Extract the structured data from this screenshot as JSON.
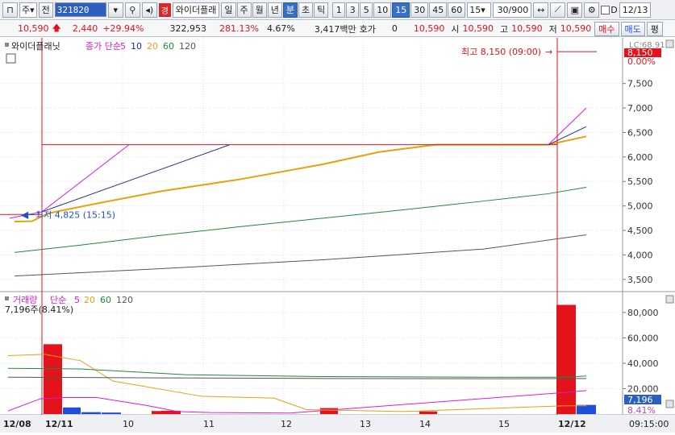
{
  "toolbar": {
    "mode": "주",
    "type": "전",
    "code": "321820",
    "name": "와이더플래",
    "badge": "경",
    "periods": [
      "일",
      "주",
      "월",
      "년",
      "분",
      "초",
      "틱"
    ],
    "active_period": "분",
    "intervals": [
      "1",
      "3",
      "5",
      "10",
      "15",
      "30",
      "45",
      "60"
    ],
    "active_interval": "15",
    "interval_select": "15",
    "count": "30/900",
    "d_label": "D",
    "date": "12/13"
  },
  "quote": {
    "price": "10,590",
    "change": "2,440",
    "change_pct": "+29.94%",
    "volume": "322,953",
    "vol_ratio": "281.13%",
    "turnover": "4.67%",
    "amount": "3,417백만",
    "hoga_label": "호가",
    "hoga": "0",
    "ask": "10,590",
    "open_label": "시",
    "open": "10,590",
    "high_label": "고",
    "high": "10,590",
    "low_label": "저",
    "low": "10,590",
    "buy": "매수",
    "sell": "매도",
    "avg": "평"
  },
  "price_panel": {
    "name": "와이더플래닛",
    "legend": [
      "종가 단순",
      "5",
      "10",
      "20",
      "60",
      "120"
    ],
    "high_annot": "최고 8,150 (09:00)",
    "low_annot": "최저 4,825 (15:15)",
    "last_tag": "8,150",
    "pct_tag": "0.00%",
    "lc_tag": "LC:68.91",
    "y_ticks": [
      "7,500",
      "7,000",
      "6,500",
      "6,000",
      "5,500",
      "5,000",
      "4,500",
      "4,000",
      "3,500"
    ]
  },
  "volume_panel": {
    "legend": [
      "거래량",
      "단순",
      "5",
      "20",
      "60",
      "120"
    ],
    "sub": "7,196주(8.41%)",
    "last_tag": "7,196",
    "pct_tag": "8.41%",
    "y_ticks": [
      "80,000",
      "60,000",
      "40,000",
      "20,000"
    ]
  },
  "x_axis": {
    "labels": [
      "12/08",
      "12/11",
      "10",
      "11",
      "12",
      "13",
      "14",
      "15",
      "12/12"
    ],
    "time": "09:15:00"
  },
  "colors": {
    "up": "#e3121b",
    "down": "#1f4fd8",
    "ma5": "#d81bd8",
    "ma10": "#1a2d8f",
    "ma20": "#e8a010",
    "ma60": "#1b8a3a",
    "ma120": "#555555"
  },
  "chart_data": {
    "type": "bar",
    "price": {
      "ylim": [
        3300,
        8300
      ],
      "high": 8150,
      "low": 4825,
      "series": [
        {
          "name": "5",
          "x": [
            12,
            52,
            160
          ],
          "values": [
            4750,
            4880,
            6250
          ]
        },
        {
          "name": "10",
          "x": [
            52,
            285
          ],
          "values": [
            4880,
            6250
          ]
        },
        {
          "name": "20",
          "x": [
            18,
            40,
            60,
            120,
            200,
            300,
            400,
            470,
            540,
            600,
            680,
            727
          ],
          "values": [
            4680,
            4690,
            4850,
            5050,
            5300,
            5550,
            5850,
            6100,
            6250,
            6250,
            6250,
            6420
          ]
        },
        {
          "name": "60",
          "x": [
            18,
            100,
            200,
            300,
            400,
            500,
            600,
            680,
            727
          ],
          "values": [
            4050,
            4200,
            4400,
            4580,
            4750,
            4920,
            5100,
            5250,
            5380
          ]
        },
        {
          "name": "120",
          "x": [
            18,
            200,
            400,
            600,
            727
          ],
          "values": [
            3570,
            3720,
            3900,
            4120,
            4410
          ]
        }
      ],
      "recent_5": {
        "x": [
          680,
          727
        ],
        "values": [
          6250,
          7000
        ]
      },
      "recent_10": {
        "x": [
          680,
          727
        ],
        "values": [
          6250,
          6620
        ]
      }
    },
    "volume": {
      "ylim": [
        0,
        92000
      ],
      "bars": [
        {
          "x": 54,
          "w": 23,
          "value": 55000,
          "dir": "up"
        },
        {
          "x": 78,
          "w": 22,
          "value": 5200,
          "dir": "down"
        },
        {
          "x": 101,
          "w": 24,
          "value": 1500,
          "dir": "down"
        },
        {
          "x": 126,
          "w": 24,
          "value": 1200,
          "dir": "down"
        },
        {
          "x": 188,
          "w": 24,
          "value": 2400,
          "dir": "up"
        },
        {
          "x": 200,
          "w": 24,
          "value": 2600,
          "dir": "up"
        },
        {
          "x": 397,
          "w": 22,
          "value": 4700,
          "dir": "up"
        },
        {
          "x": 520,
          "w": 22,
          "value": 2100,
          "dir": "up"
        },
        {
          "x": 690,
          "w": 24,
          "value": 86000,
          "dir": "up"
        },
        {
          "x": 715,
          "w": 24,
          "value": 7196,
          "dir": "down"
        }
      ],
      "ma_series": [
        {
          "name": "5",
          "x": [
            10,
            50,
            80,
            120,
            180,
            220,
            260,
            360,
            700,
            727
          ],
          "values": [
            2500,
            12000,
            13000,
            13000,
            7000,
            2000,
            1200,
            800,
            17000,
            18500
          ]
        },
        {
          "name": "20",
          "x": [
            10,
            55,
            100,
            140,
            250,
            340,
            380,
            500,
            700,
            727
          ],
          "values": [
            46000,
            47000,
            42000,
            26000,
            14000,
            12500,
            3500,
            2000,
            6500,
            6500
          ]
        },
        {
          "name": "60",
          "x": [
            10,
            100,
            230,
            400,
            600,
            700,
            727
          ],
          "values": [
            36000,
            35500,
            31000,
            29500,
            29000,
            29000,
            30000
          ]
        },
        {
          "name": "120",
          "x": [
            10,
            200,
            400,
            600,
            727
          ],
          "values": [
            29000,
            28500,
            28000,
            27800,
            28000
          ]
        }
      ]
    }
  }
}
